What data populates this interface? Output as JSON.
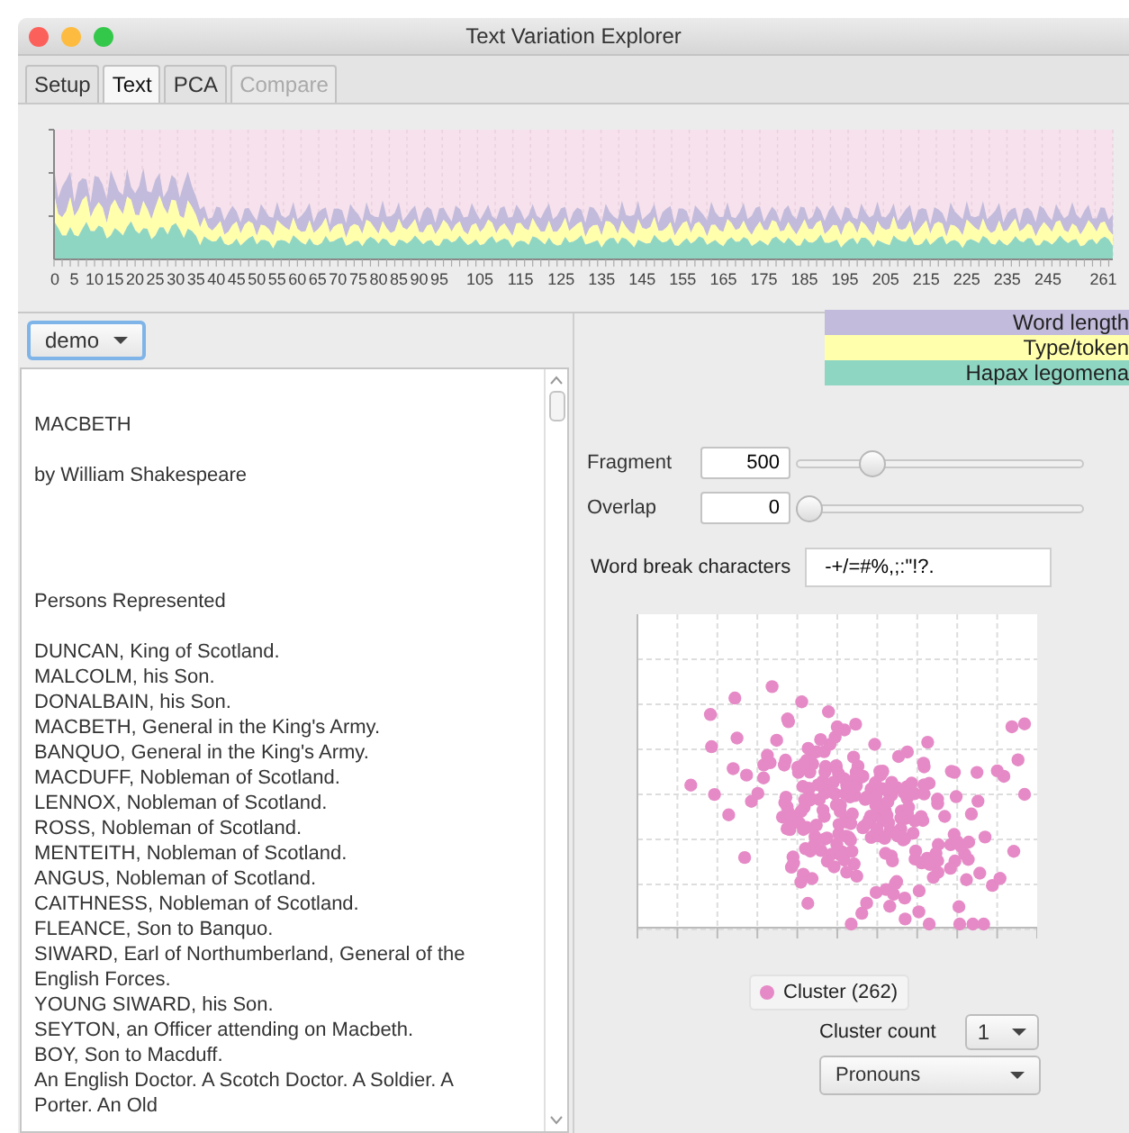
{
  "window": {
    "title": "Text Variation Explorer"
  },
  "tabs": [
    {
      "label": "Setup",
      "selected": false,
      "disabled": false
    },
    {
      "label": "Text",
      "selected": true,
      "disabled": false
    },
    {
      "label": "PCA",
      "selected": false,
      "disabled": false
    },
    {
      "label": "Compare",
      "selected": false,
      "disabled": true
    }
  ],
  "area_chart": {
    "x_tick_labels": [
      "0",
      "5",
      "10",
      "15",
      "20",
      "25",
      "30",
      "35",
      "40",
      "45",
      "50",
      "55",
      "60",
      "65",
      "70",
      "75",
      "80",
      "85",
      "90",
      "95",
      "105",
      "115",
      "125",
      "135",
      "145",
      "155",
      "165",
      "175",
      "185",
      "195",
      "205",
      "215",
      "225",
      "235",
      "245",
      "261"
    ]
  },
  "document_select": {
    "value": "demo"
  },
  "text_blocks": [
    [
      "MACBETH"
    ],
    [
      "by William Shakespeare"
    ],
    [
      "Persons Represented"
    ],
    [
      "DUNCAN, King of Scotland.",
      "MALCOLM, his Son.",
      "DONALBAIN, his Son.",
      "MACBETH, General in the King's Army.",
      "BANQUO, General in the King's Army.",
      "MACDUFF, Nobleman of Scotland.",
      "LENNOX, Nobleman of Scotland.",
      "ROSS, Nobleman of Scotland.",
      "MENTEITH, Nobleman of Scotland.",
      "ANGUS, Nobleman of Scotland.",
      "CAITHNESS, Nobleman of Scotland.",
      "FLEANCE, Son to Banquo.",
      "SIWARD, Earl of Northumberland, General of the English Forces.",
      "YOUNG SIWARD, his Son.",
      "SEYTON, an Officer attending on Macbeth.",
      "BOY, Son to Macduff.",
      "An English Doctor. A Scotch Doctor. A Soldier. A Porter. An Old"
    ]
  ],
  "legend": [
    {
      "label": "Word length",
      "color": "#c2bbdb"
    },
    {
      "label": "Type/token",
      "color": "#ffffac"
    },
    {
      "label": "Hapax legomena",
      "color": "#8fd6c2"
    }
  ],
  "sliders": [
    {
      "label": "Fragment",
      "value": "500",
      "level": 0.24
    },
    {
      "label": "Overlap",
      "value": "0",
      "level": 0
    }
  ],
  "word_break": {
    "label": "Word break characters",
    "value": "-+/=#%,;:\"!?."
  },
  "scatter_legend": {
    "label": "Cluster (262)",
    "color": "#e58ac6"
  },
  "cluster_count": {
    "label": "Cluster count",
    "value": "1"
  },
  "feature_select": {
    "value": "Pronouns"
  }
}
